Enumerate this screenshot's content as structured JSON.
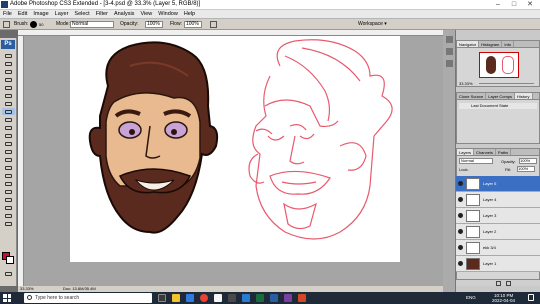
{
  "title": "Adobe Photoshop CS3 Extended - [3-4.psd @ 33.3% (Layer 5, RGB/8)]",
  "menu": [
    "File",
    "Edit",
    "Image",
    "Layer",
    "Select",
    "Filter",
    "Analysis",
    "View",
    "Window",
    "Help"
  ],
  "options": {
    "brush_label": "Brush:",
    "brush_size": "50",
    "mode_label": "Mode:",
    "mode_value": "Normal",
    "opacity_label": "Opacity:",
    "opacity_value": "100%",
    "flow_label": "Flow:",
    "flow_value": "100%",
    "workspace": "Workspace ▾"
  },
  "toolbox_title": "Ps",
  "status": {
    "zoom": "33.33%",
    "doc": "Doc: 13.8M/35.4M"
  },
  "navigator": {
    "tabs": [
      "Navigator",
      "Histogram",
      "Info"
    ],
    "zoom": "33.33%"
  },
  "history": {
    "tabs": [
      "Clone Source",
      "Layer Comps",
      "History"
    ],
    "item": "Last Document State"
  },
  "layers": {
    "tabs": [
      "Layers",
      "Channels",
      "Paths"
    ],
    "blend": "Normal",
    "opacity_label": "Opacity:",
    "opacity_value": "100%",
    "fill_label": "Fill:",
    "fill_value": "100%",
    "lock_label": "Lock:",
    "rows": [
      "Layer 5",
      "Layer 4",
      "Layer 3",
      "Layer 2",
      "ekk 3/4",
      "Layer 1"
    ]
  },
  "taskbar": {
    "search_placeholder": "Type here to search",
    "lang": "ENG",
    "time": "10:10 PM",
    "date": "2022-04-04"
  },
  "colors": {
    "selected_layer": "#3a6fc4",
    "sketch_line": "#e85a6e",
    "beard": "#5a2a1e",
    "skin": "#e9b98f"
  }
}
